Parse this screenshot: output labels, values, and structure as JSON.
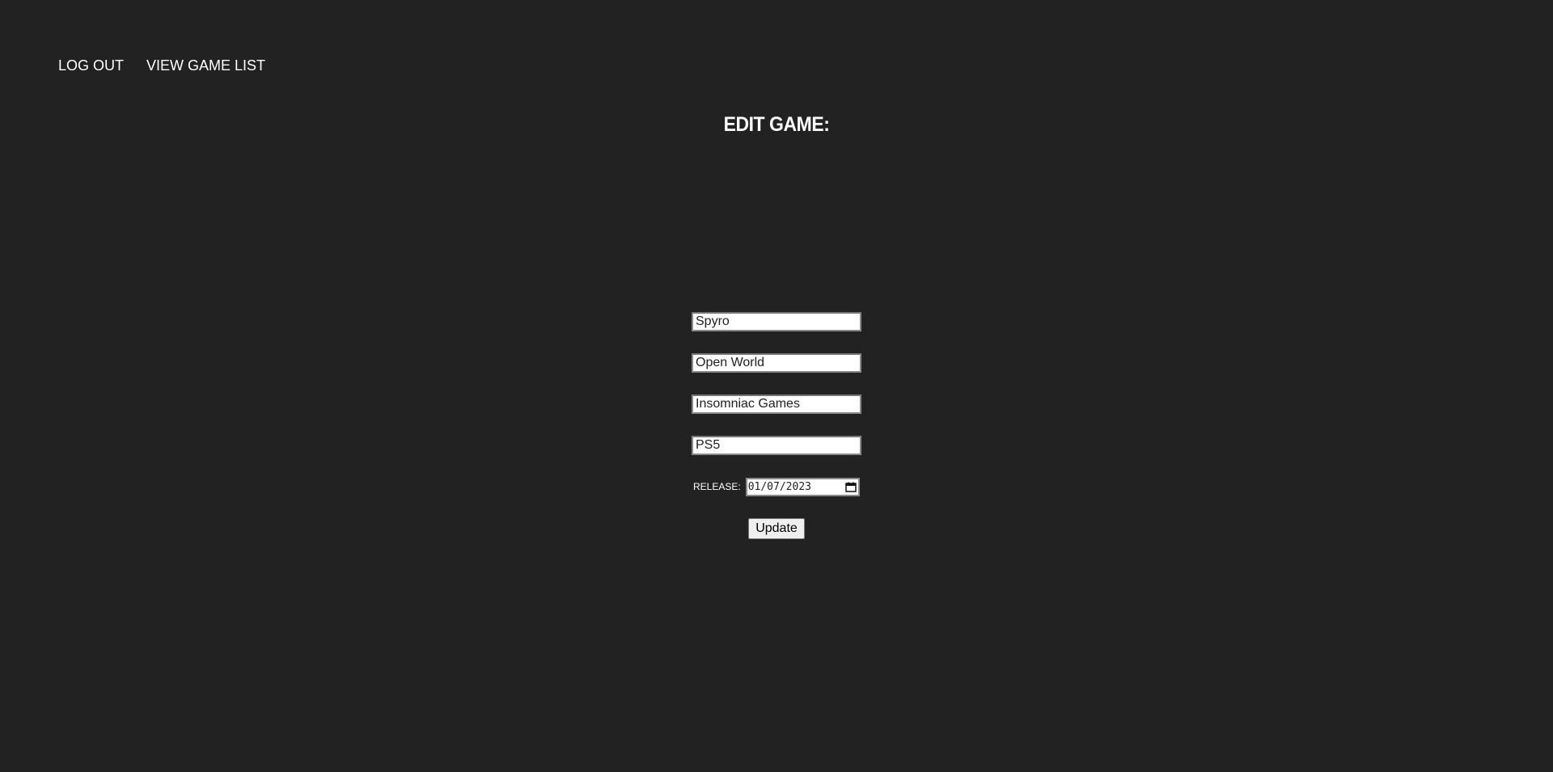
{
  "nav": {
    "logout_label": "LOG OUT",
    "view_list_label": "VIEW GAME LIST"
  },
  "page": {
    "title": "EDIT GAME:"
  },
  "form": {
    "name_value": "Spyro",
    "genre_value": "Open World",
    "developer_value": "Insomniac Games",
    "platform_value": "PS5",
    "release_label": "RELEASE:",
    "release_value": "01/07/2023",
    "submit_label": "Update"
  },
  "colors": {
    "background": "#222222",
    "text": "#ffffff",
    "button_bg": "#efefef"
  },
  "icons": {
    "date_picker": "calendar-icon"
  }
}
